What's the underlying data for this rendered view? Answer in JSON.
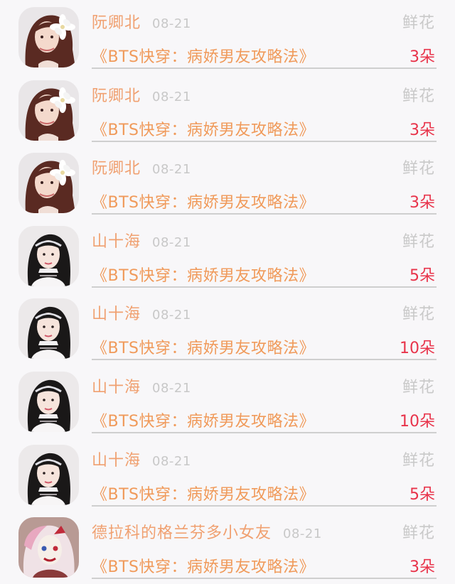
{
  "gift_list": [
    {
      "avatar": "red-hair-woman-flower",
      "user": "阮卿北",
      "date": "08-21",
      "gift_type": "鲜花",
      "book": "《BTS快穿：病娇男友攻略法》",
      "count": "3朵"
    },
    {
      "avatar": "red-hair-woman-flower",
      "user": "阮卿北",
      "date": "08-21",
      "gift_type": "鲜花",
      "book": "《BTS快穿：病娇男友攻略法》",
      "count": "3朵"
    },
    {
      "avatar": "red-hair-woman-flower",
      "user": "阮卿北",
      "date": "08-21",
      "gift_type": "鲜花",
      "book": "《BTS快穿：病娇男友攻略法》",
      "count": "3朵"
    },
    {
      "avatar": "black-hair-woman-headband",
      "user": "山十海",
      "date": "08-21",
      "gift_type": "鲜花",
      "book": "《BTS快穿：病娇男友攻略法》",
      "count": "5朵"
    },
    {
      "avatar": "black-hair-woman-headband",
      "user": "山十海",
      "date": "08-21",
      "gift_type": "鲜花",
      "book": "《BTS快穿：病娇男友攻略法》",
      "count": "10朵"
    },
    {
      "avatar": "black-hair-woman-headband",
      "user": "山十海",
      "date": "08-21",
      "gift_type": "鲜花",
      "book": "《BTS快穿：病娇男友攻略法》",
      "count": "10朵"
    },
    {
      "avatar": "black-hair-woman-headband",
      "user": "山十海",
      "date": "08-21",
      "gift_type": "鲜花",
      "book": "《BTS快穿：病娇男友攻略法》",
      "count": "5朵"
    },
    {
      "avatar": "clown-makeup-character",
      "user": "德拉科的格兰芬多小女友",
      "date": "08-21",
      "gift_type": "鲜花",
      "book": "《BTS快穿：病娇男友攻略法》",
      "count": "3朵"
    }
  ],
  "colors": {
    "username": "#f0a070",
    "book_title": "#f09a5a",
    "count": "#e8334a",
    "muted": "#c8c8c8",
    "background": "#f8f7f9"
  }
}
